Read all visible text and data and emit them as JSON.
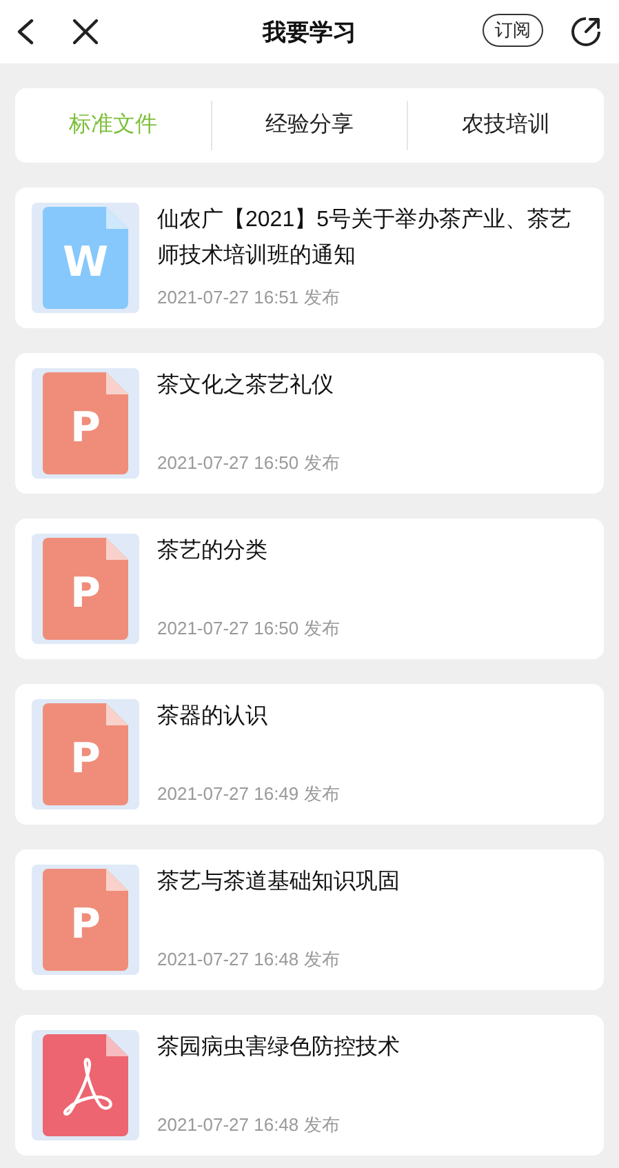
{
  "header": {
    "title": "我要学习",
    "subscribe": "订阅"
  },
  "tabs": [
    {
      "label": "标准文件",
      "selected": true
    },
    {
      "label": "经验分享",
      "selected": false
    },
    {
      "label": "农技培训",
      "selected": false
    }
  ],
  "documents": [
    {
      "kind": "word",
      "badge": "W",
      "title": "仙农广【2021】5号关于举办茶产业、茶艺师技术培训班的通知",
      "date": "2021-07-27 16:51 发布"
    },
    {
      "kind": "ppt",
      "badge": "P",
      "title": "茶文化之茶艺礼仪",
      "date": "2021-07-27 16:50 发布"
    },
    {
      "kind": "ppt",
      "badge": "P",
      "title": "茶艺的分类",
      "date": "2021-07-27 16:50 发布"
    },
    {
      "kind": "ppt",
      "badge": "P",
      "title": "茶器的认识",
      "date": "2021-07-27 16:49 发布"
    },
    {
      "kind": "ppt",
      "badge": "P",
      "title": "茶艺与茶道基础知识巩固",
      "date": "2021-07-27 16:48 发布"
    },
    {
      "kind": "pdf",
      "title": "茶园病虫害绿色防控技术",
      "date": "2021-07-27 16:48 发布"
    }
  ]
}
